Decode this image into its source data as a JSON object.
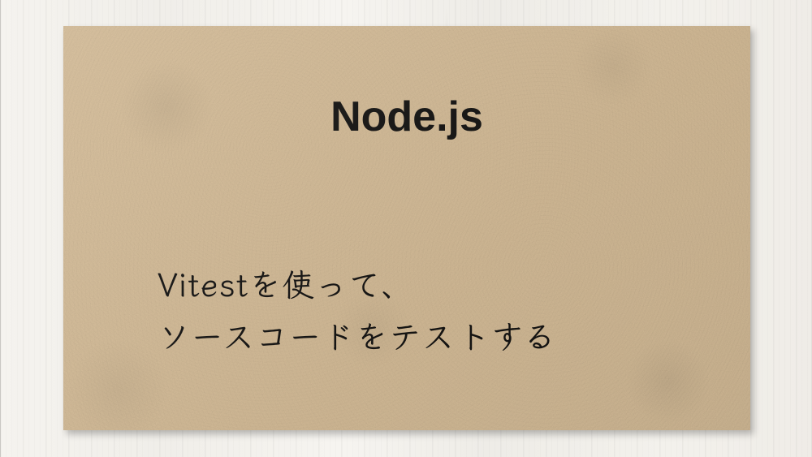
{
  "card": {
    "title": "Node.js",
    "subtitle_line1": "Vitestを使って、",
    "subtitle_line2": "ソースコードをテストする"
  }
}
